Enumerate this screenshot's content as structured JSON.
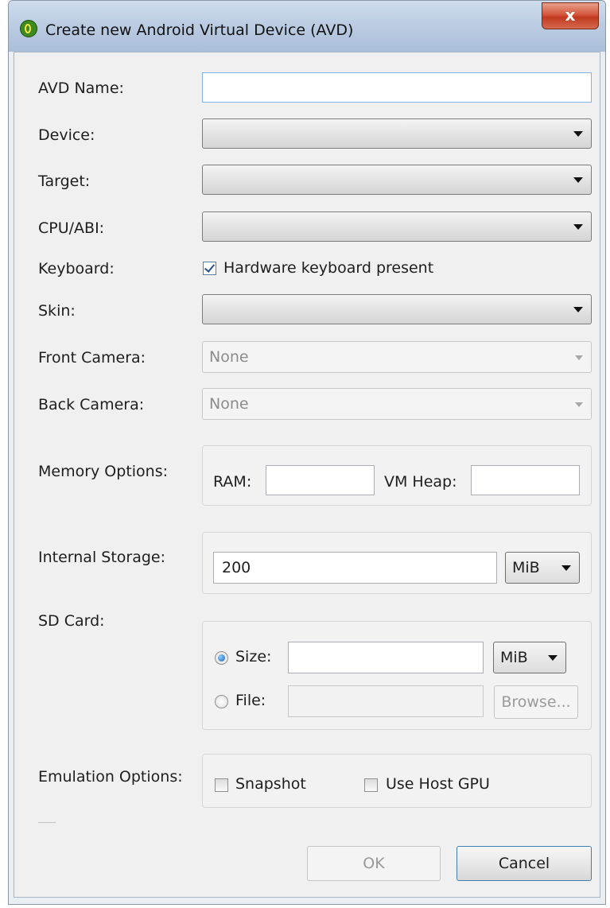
{
  "window": {
    "title": "Create new Android Virtual Device (AVD)",
    "close_label": "x",
    "app_icon": "android-eclipse-icon"
  },
  "form": {
    "avd_name_label": "AVD Name:",
    "avd_name_value": "",
    "device_label": "Device:",
    "device_value": "",
    "target_label": "Target:",
    "target_value": "",
    "cpu_label": "CPU/ABI:",
    "cpu_value": "",
    "keyboard_label": "Keyboard:",
    "keyboard_checkbox_label": "Hardware keyboard present",
    "keyboard_checked": true,
    "skin_label": "Skin:",
    "skin_value": "",
    "front_camera_label": "Front Camera:",
    "front_camera_value": "None",
    "back_camera_label": "Back Camera:",
    "back_camera_value": "None"
  },
  "memory": {
    "label": "Memory Options:",
    "ram_label": "RAM:",
    "ram_value": "",
    "vm_heap_label": "VM Heap:",
    "vm_heap_value": ""
  },
  "storage": {
    "label": "Internal Storage:",
    "value": "200",
    "unit": "MiB"
  },
  "sdcard": {
    "label": "SD Card:",
    "size_label": "Size:",
    "size_value": "",
    "size_unit": "MiB",
    "size_selected": true,
    "file_label": "File:",
    "file_value": "",
    "browse_label": "Browse..."
  },
  "emulation": {
    "label": "Emulation Options:",
    "snapshot_label": "Snapshot",
    "snapshot_checked": false,
    "host_gpu_label": "Use Host GPU",
    "host_gpu_checked": false
  },
  "buttons": {
    "ok_label": "OK",
    "cancel_label": "Cancel"
  },
  "colors": {
    "titlebar": "#bccde3",
    "close_button": "#c0391f",
    "dialog_background": "#f0f0f0",
    "focus_border": "#7eb4ea"
  }
}
